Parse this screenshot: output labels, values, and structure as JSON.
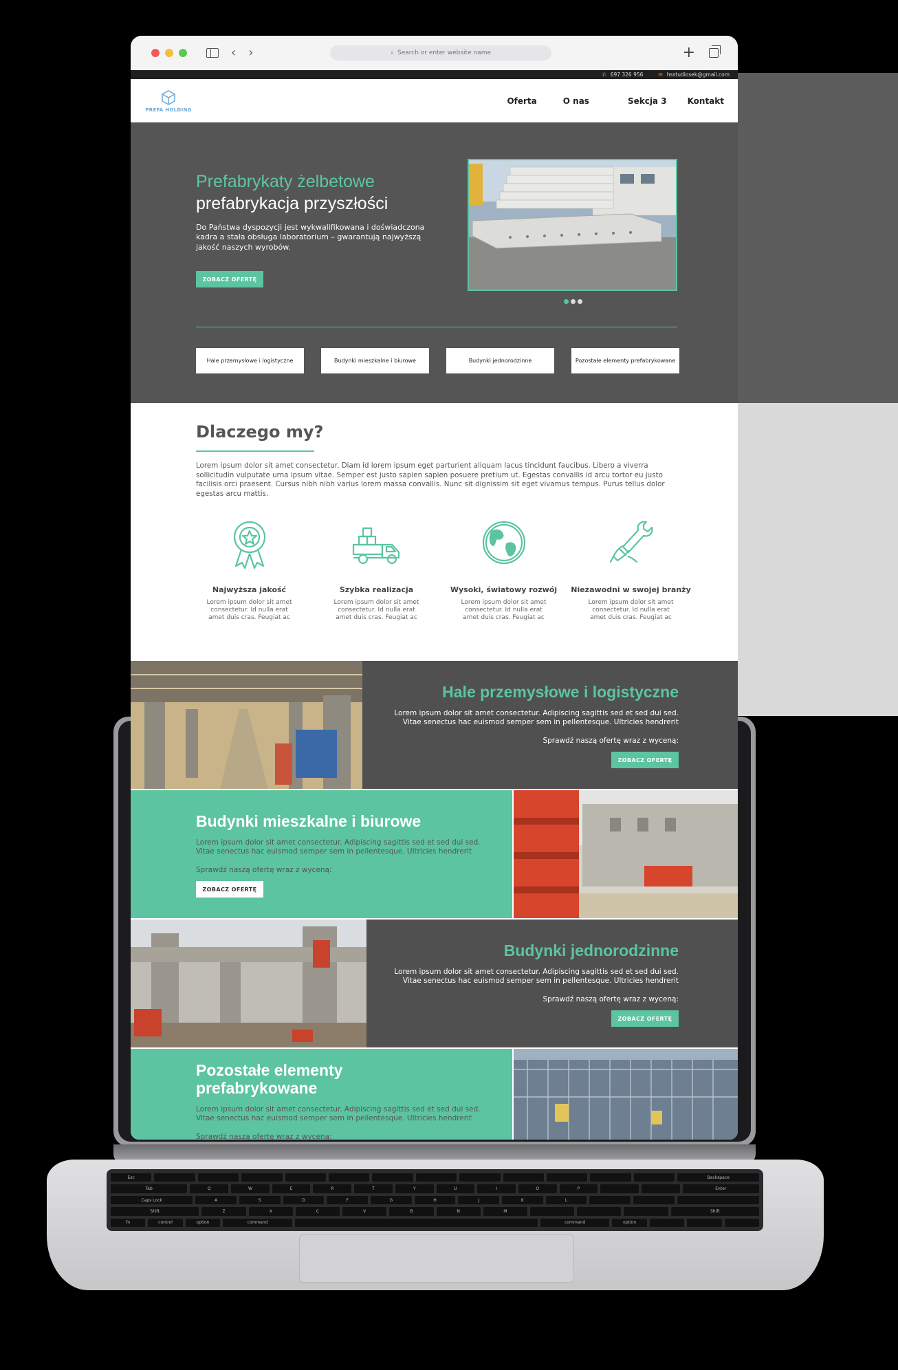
{
  "browser": {
    "url_placeholder": "Search or enter website name",
    "colors": {
      "accent": "#5cc4a0",
      "dark": "#555556"
    }
  },
  "topbar": {
    "phone": "697 326 956",
    "email": "hsstudiosek@gmail.com"
  },
  "logo": {
    "text": "PREFA HOLDING"
  },
  "nav": {
    "items": [
      {
        "label": "Oferta"
      },
      {
        "label": "O nas"
      },
      {
        "label": "Sekcja 3"
      },
      {
        "label": "Kontakt"
      }
    ]
  },
  "hero": {
    "title_accent": "Prefabrykaty żelbetowe",
    "title_main": "prefabrykacja przyszłości",
    "description": "Do Państwa dyspozycji jest wykwalifikowana i doświadczona kadra a stała obsługa laboratorium – gwarantują najwyższą jakość naszych wyrobów.",
    "button": "ZOBACZ OFERTĘ",
    "categories": [
      {
        "label": "Hale przemysłowe i logistyczne"
      },
      {
        "label": "Budynki mieszkalne i biurowe"
      },
      {
        "label": "Budynki jednorodzinne"
      },
      {
        "label": "Pozostałe elementy prefabrykowane"
      }
    ]
  },
  "why": {
    "title": "Dlaczego my?",
    "text": "Lorem ipsum dolor sit amet consectetur. Diam id lorem ipsum eget parturient aliquam lacus tincidunt faucibus. Libero a viverra sollicitudin vulputate urna ipsum vitae. Semper est justo sapien sapien posuere pretium ut. Egestas convallis id arcu tortor eu justo facilisis orci praesent. Cursus nibh nibh varius lorem massa convallis. Nunc sit dignissim sit eget vivamus tempus. Purus tellus dolor egestas arcu mattis.",
    "features": [
      {
        "title": "Najwyższa jakość",
        "text": "Lorem ipsum dolor sit amet consectetur. Id nulla erat amet duis cras. Feugiat ac",
        "icon": "award-ribbon-icon"
      },
      {
        "title": "Szybka realizacja",
        "text": "Lorem ipsum dolor sit amet consectetur. Id nulla erat amet duis cras. Feugiat ac",
        "icon": "delivery-truck-icon"
      },
      {
        "title": "Wysoki, światowy rozwój",
        "text": "Lorem ipsum dolor sit amet consectetur. Id nulla erat amet duis cras. Feugiat ac",
        "icon": "globe-icon"
      },
      {
        "title": "Niezawodni w swojej branży",
        "text": "Lorem ipsum dolor sit amet consectetur. Id nulla erat amet duis cras. Feugiat ac",
        "icon": "wrench-hand-icon"
      }
    ]
  },
  "offers": [
    {
      "title": "Hale przemysłowe i logistyczne",
      "text": "Lorem ipsum dolor sit amet consectetur. Adipiscing sagittis sed et sed dui sed. Vitae senectus hac euismod semper sem in pellentesque. Ultricies hendrerit",
      "cta": "Sprawdź naszą ofertę wraz z wyceną:",
      "button": "ZOBACZ OFERTĘ"
    },
    {
      "title": "Budynki mieszkalne i biurowe",
      "text": "Lorem ipsum dolor sit amet consectetur. Adipiscing sagittis sed et sed dui sed. Vitae senectus hac euismod semper sem in pellentesque. Ultricies hendrerit",
      "cta": "Sprawdź naszą ofertę wraz z wyceną:",
      "button": "ZOBACZ OFERTĘ"
    },
    {
      "title": "Budynki jednorodzinne",
      "text": "Lorem ipsum dolor sit amet consectetur. Adipiscing sagittis sed et sed dui sed. Vitae senectus hac euismod semper sem in pellentesque. Ultricies hendrerit",
      "cta": "Sprawdź naszą ofertę wraz z wyceną:",
      "button": "ZOBACZ OFERTĘ"
    },
    {
      "title": "Pozostałe elementy prefabrykowane",
      "text": "Lorem ipsum dolor sit amet consectetur. Adipiscing sagittis sed et sed dui sed. Vitae senectus hac euismod semper sem in pellentesque. Ultricies hendrerit",
      "cta": "Sprawdź naszą ofertę wraz z wyceną:"
    }
  ],
  "keyboard": {
    "row1": [
      "Esc",
      "Backspace"
    ],
    "row2": [
      "Tab",
      "Q",
      "W",
      "E",
      "R",
      "T",
      "Y",
      "U",
      "I",
      "O",
      "P",
      "Enter"
    ],
    "row3": [
      "Caps Lock",
      "A",
      "S",
      "D",
      "F",
      "G",
      "H",
      "J",
      "K",
      "L"
    ],
    "row4": [
      "Shift",
      "Z",
      "X",
      "C",
      "V",
      "B",
      "N",
      "M",
      "Shift"
    ],
    "row5": [
      "fn",
      "control",
      "option",
      "command",
      "command",
      "option"
    ]
  }
}
